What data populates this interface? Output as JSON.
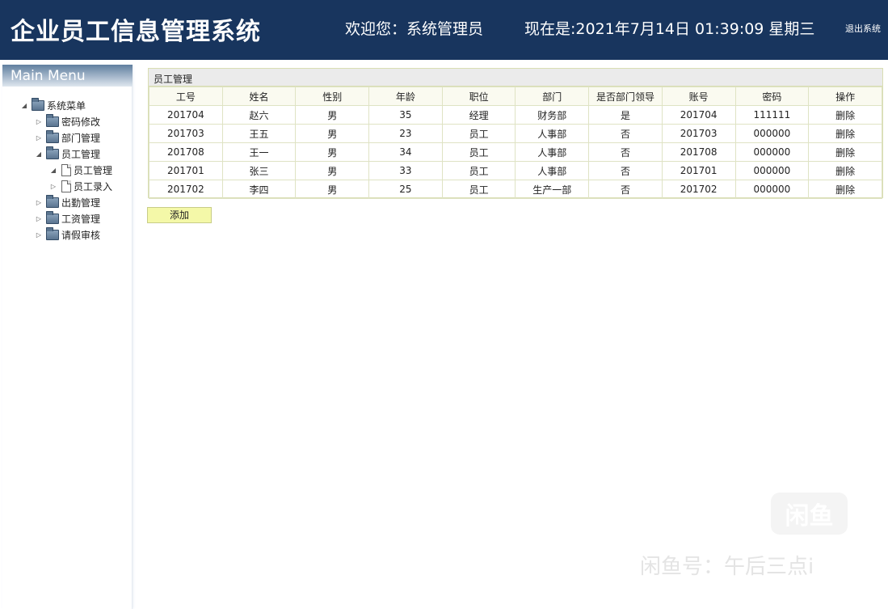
{
  "header": {
    "title": "企业员工信息管理系统",
    "welcome": "欢迎您：系统管理员",
    "clock": "现在是:2021年7月14日 01:39:09 星期三",
    "logout": "退出系统"
  },
  "sidebar": {
    "menu_title": "Main Menu",
    "root": "系统菜单",
    "items": [
      {
        "label": "密码修改"
      },
      {
        "label": "部门管理"
      },
      {
        "label": "员工管理"
      },
      {
        "label": "员工管理"
      },
      {
        "label": "员工录入"
      },
      {
        "label": "出勤管理"
      },
      {
        "label": "工资管理"
      },
      {
        "label": "请假审核"
      }
    ]
  },
  "panel": {
    "title": "员工管理",
    "columns": [
      "工号",
      "姓名",
      "性别",
      "年龄",
      "职位",
      "部门",
      "是否部门领导",
      "账号",
      "密码",
      "操作"
    ],
    "rows": [
      [
        "201704",
        "赵六",
        "男",
        "35",
        "经理",
        "财务部",
        "是",
        "201704",
        "111111",
        "删除"
      ],
      [
        "201703",
        "王五",
        "男",
        "23",
        "员工",
        "人事部",
        "否",
        "201703",
        "000000",
        "删除"
      ],
      [
        "201708",
        "王一",
        "男",
        "34",
        "员工",
        "人事部",
        "否",
        "201708",
        "000000",
        "删除"
      ],
      [
        "201701",
        "张三",
        "男",
        "33",
        "员工",
        "人事部",
        "否",
        "201701",
        "000000",
        "删除"
      ],
      [
        "201702",
        "李四",
        "男",
        "25",
        "员工",
        "生产一部",
        "否",
        "201702",
        "000000",
        "删除"
      ]
    ],
    "add_label": "添加"
  },
  "watermark": {
    "logo": "闲鱼",
    "text": "闲鱼号：午后三点i"
  }
}
